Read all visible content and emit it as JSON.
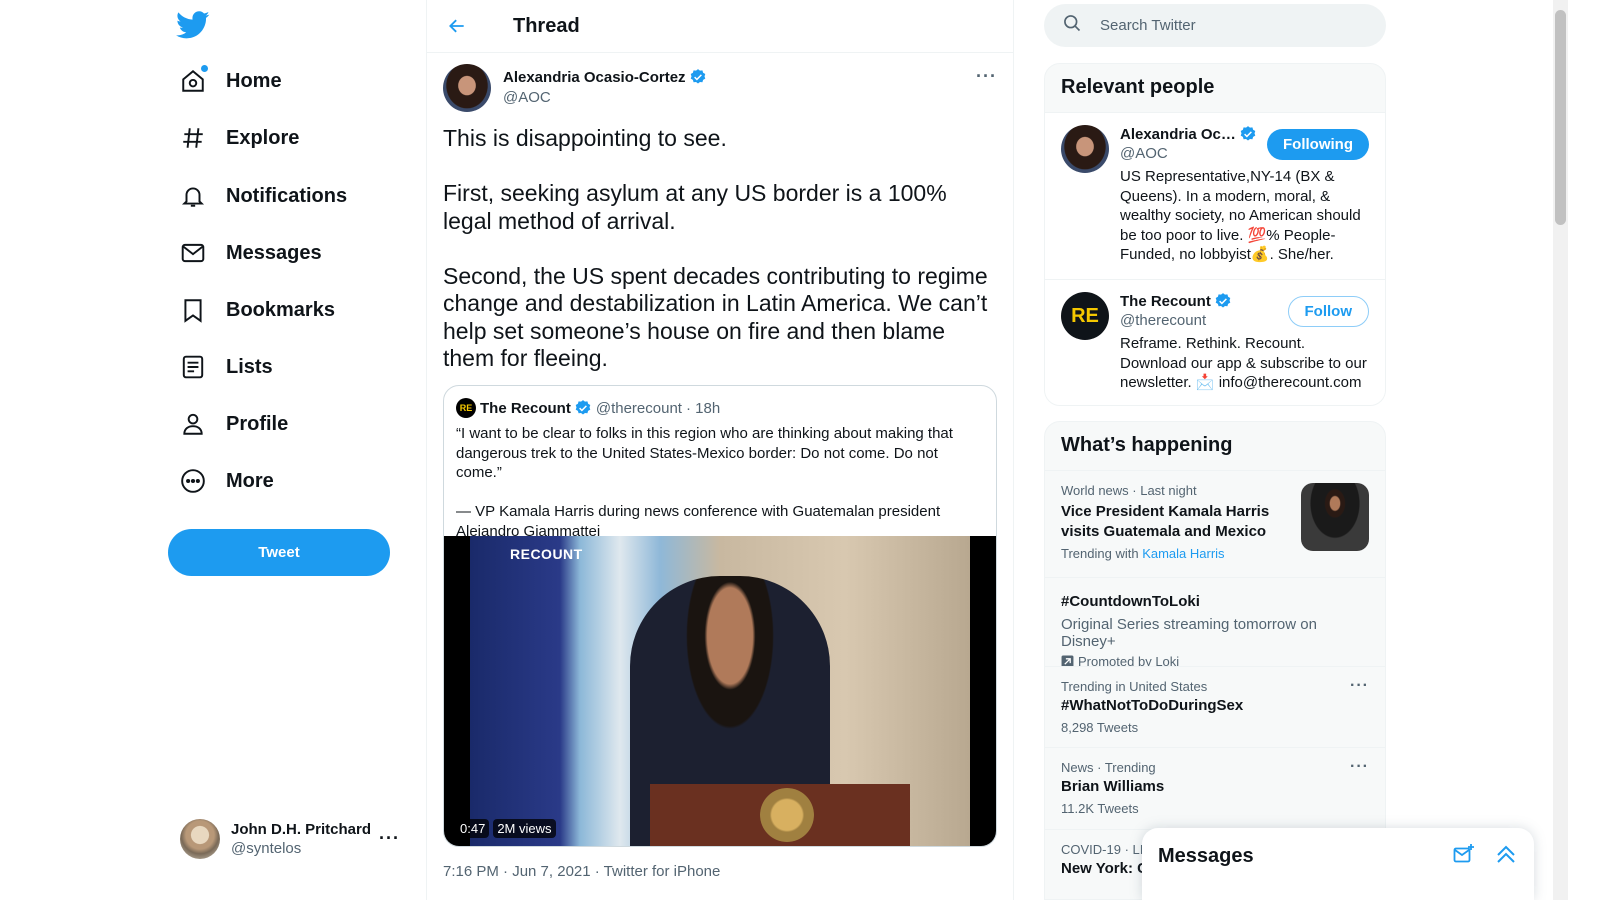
{
  "nav": {
    "items": [
      {
        "label": "Home",
        "icon": "home-icon"
      },
      {
        "label": "Explore",
        "icon": "hashtag-icon"
      },
      {
        "label": "Notifications",
        "icon": "bell-icon"
      },
      {
        "label": "Messages",
        "icon": "envelope-icon"
      },
      {
        "label": "Bookmarks",
        "icon": "bookmark-icon"
      },
      {
        "label": "Lists",
        "icon": "list-icon"
      },
      {
        "label": "Profile",
        "icon": "person-icon"
      },
      {
        "label": "More",
        "icon": "more-circle-icon"
      }
    ],
    "tweet_button": "Tweet",
    "account": {
      "display_name": "John D.H. Pritchard",
      "handle": "@syntelos"
    }
  },
  "thread": {
    "header_title": "Thread",
    "author": {
      "name": "Alexandria Ocasio-Cortez",
      "handle": "@AOC"
    },
    "paragraphs": [
      "This is disappointing to see.",
      "First, seeking asylum at any US border is a 100% legal method of arrival.",
      "Second, the US spent decades contributing to regime change and destabilization in Latin America. We can’t help set someone’s house on fire and then blame them for fleeing."
    ],
    "quote": {
      "avatar_text": "RE",
      "name": "The Recount",
      "handle": "@therecount",
      "time": "· 18h",
      "paragraphs": [
        "“I want to be clear to folks in this region who are thinking about making that dangerous trek to the United States-Mexico border: Do not come. Do not come.”",
        "— VP Kamala Harris during news conference with Guatemalan president Alejandro Giammattei"
      ],
      "video": {
        "watermark": "RECOUNT",
        "duration": "0:47",
        "views": "2M views"
      }
    },
    "meta": "7:16 PM · Jun 7, 2021 · Twitter for iPhone"
  },
  "sidebar": {
    "search_placeholder": "Search Twitter",
    "relevant": {
      "title": "Relevant people",
      "people": [
        {
          "name": "Alexandria Oc…",
          "handle": "@AOC",
          "button": "Following",
          "bio": "US Representative,NY-14 (BX & Queens). In a modern, moral, & wealthy society, no American should be too poor to live. 💯% People-Funded, no lobbyist💰. She/her."
        },
        {
          "name": "The Recount",
          "handle": "@therecount",
          "button": "Follow",
          "avatar_text": "RE",
          "bio": "Reframe. Rethink. Recount. Download our app & subscribe to our newsletter. 📩 info@therecount.com"
        }
      ]
    },
    "happening": {
      "title": "What’s happening",
      "trends": [
        {
          "meta": "World news · Last night",
          "title": "Vice President Kamala Harris visits Guatemala and Mexico",
          "sub_prefix": "Trending with",
          "sub_link": "Kamala Harris"
        },
        {
          "title": "#CountdownToLoki",
          "desc": "Original Series streaming tomorrow on Disney+",
          "promoted": "Promoted by Loki"
        },
        {
          "meta": "Trending in United States",
          "title": "#WhatNotToDoDuringSex",
          "count": "8,298 Tweets"
        },
        {
          "meta": "News · Trending",
          "title": "Brian Williams",
          "count": "11.2K Tweets"
        },
        {
          "meta": "COVID-19 · LI",
          "title": "New York: C"
        }
      ]
    }
  },
  "messages_drawer": {
    "title": "Messages"
  },
  "colors": {
    "accent": "#1d9bf0",
    "text": "#0f1419",
    "muted": "#536471"
  }
}
